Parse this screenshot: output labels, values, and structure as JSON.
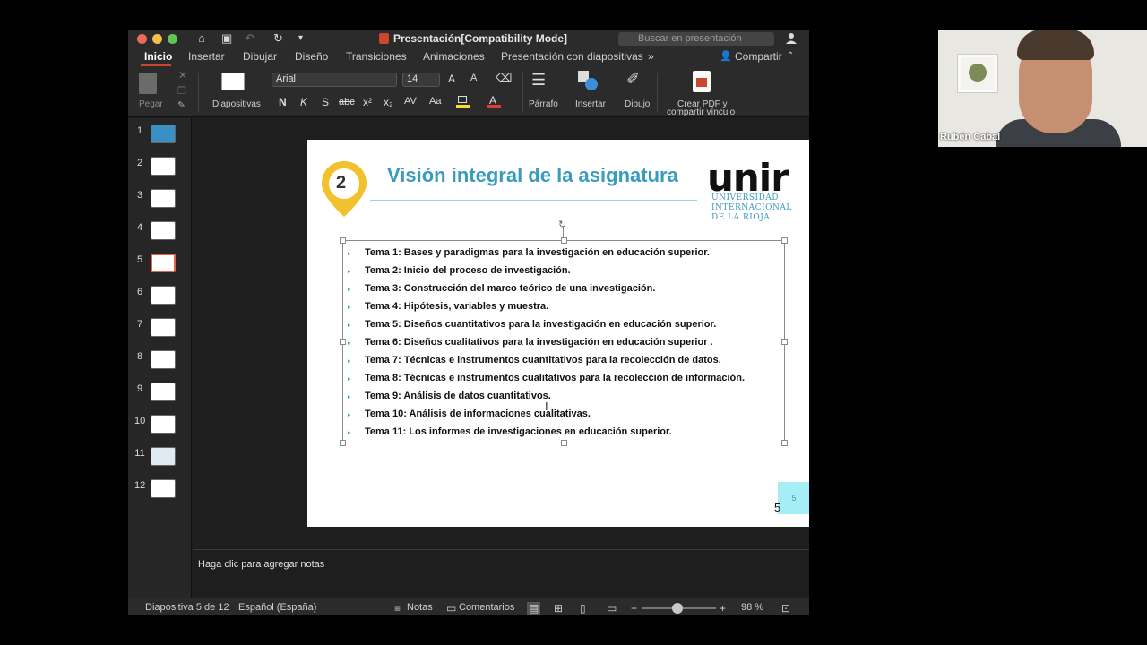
{
  "window": {
    "title": "Presentación[Compatibility Mode]",
    "search_placeholder": "Buscar en presentación"
  },
  "tabs": [
    "Inicio",
    "Insertar",
    "Dibujar",
    "Diseño",
    "Transiciones",
    "Animaciones",
    "Presentación con diapositivas"
  ],
  "share_label": "Compartir",
  "ribbon": {
    "paste": "Pegar",
    "slides": "Diapositivas",
    "font": "Arial",
    "size": "14",
    "paragraph": "Párrafo",
    "insert": "Insertar",
    "draw": "Dibujo",
    "pdf_line1": "Crear PDF y",
    "pdf_line2": "compartir vínculo"
  },
  "thumbnails": [
    "1",
    "2",
    "3",
    "4",
    "5",
    "6",
    "7",
    "8",
    "9",
    "10",
    "11",
    "12"
  ],
  "selected_slide": 5,
  "slide": {
    "marker_number": "2",
    "title": "Visión integral de la asignatura",
    "logo": "unir",
    "logo_sub1": "UNIVERSIDAD",
    "logo_sub2": "INTERNACIONAL",
    "logo_sub3": "DE LA RIOJA",
    "bullet_glyph": "▸",
    "bullets": [
      "Tema 1: Bases y paradigmas para la investigación en educación superior.",
      "Tema 2: Inicio del proceso de investigación.",
      "Tema 3: Construcción del marco teórico de una investigación.",
      "Tema 4: Hipótesis, variables y muestra.",
      "Tema 5: Diseños cuantitativos para la investigación en educación superior.",
      "Tema 6: Diseños cualitativos para la investigación en educación superior .",
      "Tema 7: Técnicas e instrumentos cuantitativos para la recolección de datos.",
      "Tema 8: Técnicas e instrumentos cualitativos para la recolección de información.",
      "Tema 9: Análisis de datos cuantitativos.",
      "Tema 10: Análisis de informaciones cualitativas.",
      "Tema 11: Los informes de investigaciones en educación superior."
    ],
    "page_box": "5",
    "page_number": "5"
  },
  "notes_placeholder": "Haga clic para agregar notas",
  "status": {
    "slide_info": "Diapositiva 5 de 12",
    "language": "Español (España)",
    "notes": "Notas",
    "comments": "Comentarios",
    "zoom": "98 %"
  },
  "webcam": {
    "name": "Rubén Cabal"
  },
  "colors": {
    "title_blue": "#3a9bbf",
    "marker_yellow": "#f2c12e",
    "accent": "#c9472d"
  }
}
